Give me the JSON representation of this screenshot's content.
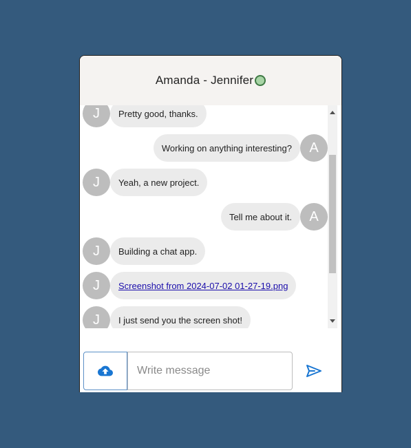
{
  "header": {
    "title": "Amanda - Jennifer",
    "status": "online"
  },
  "messages": [
    {
      "sender": "J",
      "direction": "in",
      "text": "Pretty good, thanks."
    },
    {
      "sender": "A",
      "direction": "out",
      "text": "Working on anything interesting?"
    },
    {
      "sender": "J",
      "direction": "in",
      "text": "Yeah, a new project."
    },
    {
      "sender": "A",
      "direction": "out",
      "text": "Tell me about it."
    },
    {
      "sender": "J",
      "direction": "in",
      "text": "Building a chat app."
    },
    {
      "sender": "J",
      "direction": "in",
      "text": "Screenshot from 2024-07-02 01-27-19.png",
      "is_link": true
    },
    {
      "sender": "J",
      "direction": "in",
      "text": "I just send you the screen shot!"
    }
  ],
  "composer": {
    "placeholder": "Write message",
    "value": "",
    "upload_icon": "cloud-upload-icon",
    "send_icon": "send-icon"
  },
  "colors": {
    "page_background": "#345a7d",
    "header_background": "#f5f3f1",
    "bubble": "#ebebeb",
    "avatar": "#bdbdbd",
    "accent": "#1976d2",
    "online": "#a8d4a6"
  }
}
